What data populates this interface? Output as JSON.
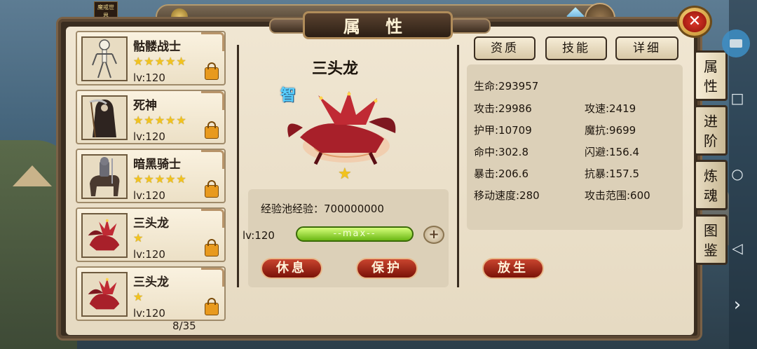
{
  "window_title": "属 性",
  "top_bar": {
    "logo_text": "魔戒世界"
  },
  "hero_list": {
    "pager": "8/35",
    "items": [
      {
        "name": "骷髅战士",
        "stars": "★★★★★",
        "level": "lv:120"
      },
      {
        "name": "死神",
        "stars": "★★★★★",
        "level": "lv:120"
      },
      {
        "name": "暗黑骑士",
        "stars": "★★★★★",
        "level": "lv:120"
      },
      {
        "name": "三头龙",
        "stars": "★",
        "level": "lv:120"
      },
      {
        "name": "三头龙",
        "stars": "★",
        "level": "lv:120"
      }
    ]
  },
  "pet": {
    "name": "三头龙",
    "badge": "智",
    "star": "★",
    "exp_pool_label": "经验池经验：700000000",
    "level": "lv:120",
    "bar_text": "--max--",
    "plus_label": "+",
    "rest_button": "休息",
    "protect_button": "保护",
    "release_button": "放生"
  },
  "tabs": {
    "aptitude": "资质",
    "skills": "技能",
    "details": "详细"
  },
  "stats": {
    "hp": "生命:293957",
    "attack": "攻击:29986",
    "attack_speed": "攻速:2419",
    "armor": "护甲:10709",
    "magic_resist": "魔抗:9699",
    "hit": "命中:302.8",
    "dodge": "闪避:156.4",
    "crit": "暴击:206.6",
    "crit_resist": "抗暴:157.5",
    "move_speed": "移动速度:280",
    "attack_range": "攻击范围:600"
  },
  "side_tabs": [
    {
      "label_top": "属",
      "label_bottom": "性"
    },
    {
      "label_top": "进",
      "label_bottom": "阶"
    },
    {
      "label_top": "炼",
      "label_bottom": "魂"
    },
    {
      "label_top": "图",
      "label_bottom": "鉴"
    }
  ],
  "nav": {
    "square": "□",
    "circle": "○",
    "back": "◁",
    "arrow": "›"
  },
  "colors": {
    "panel_bg": "#f0e6d2",
    "frame": "#3a2d20",
    "star": "#f2c31e",
    "button_red": "#c8442e",
    "bar_green": "#6ab714"
  }
}
